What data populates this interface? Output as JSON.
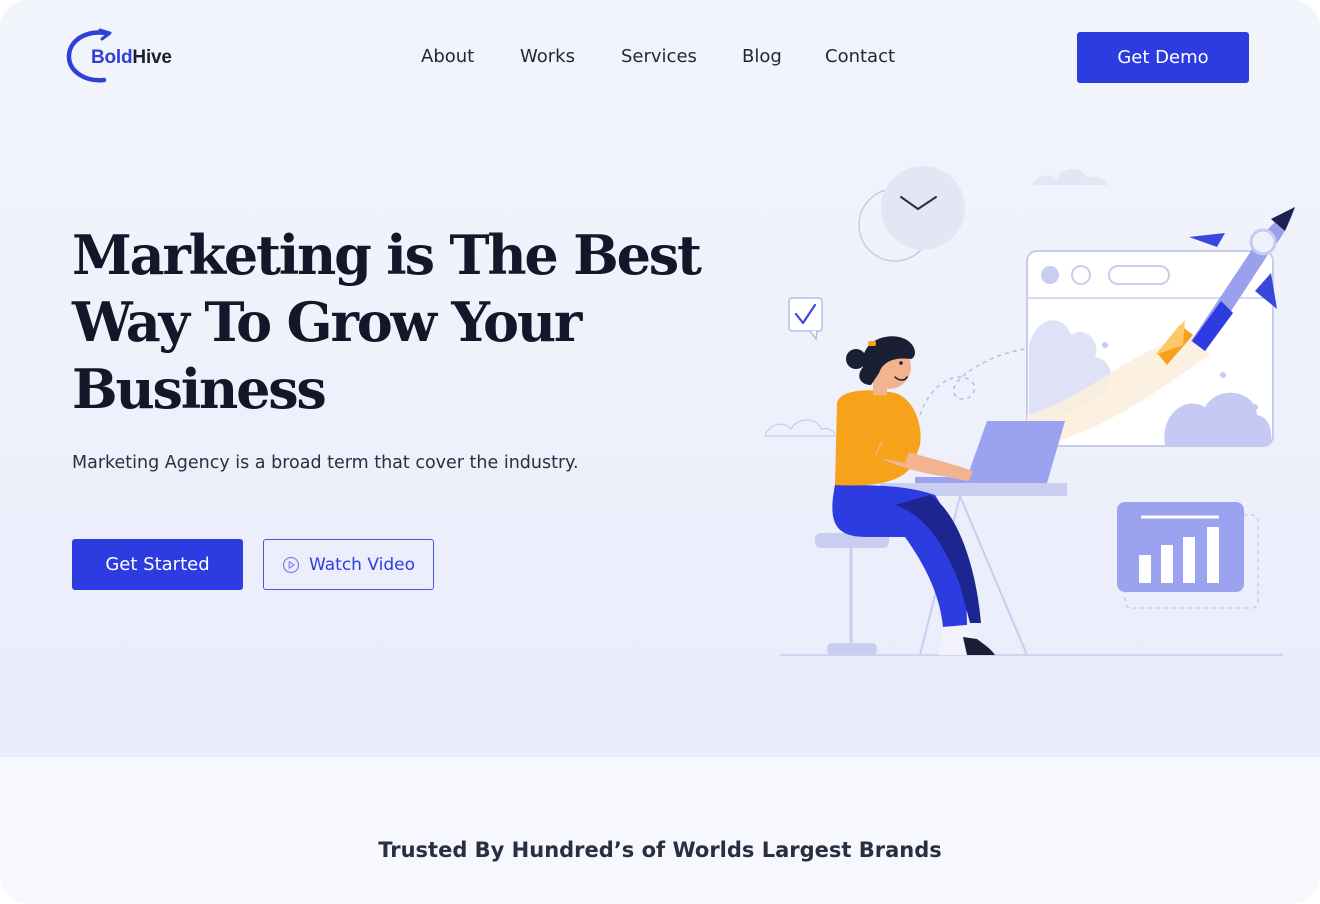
{
  "brand": {
    "name_part1": "Bold",
    "name_part2": "Hive",
    "primary_color": "#2d3ce0",
    "accent_color": "#f6a31b"
  },
  "nav": {
    "items": [
      {
        "label": "About"
      },
      {
        "label": "Works"
      },
      {
        "label": "Services"
      },
      {
        "label": "Blog"
      },
      {
        "label": "Contact"
      }
    ],
    "cta_label": "Get Demo"
  },
  "hero": {
    "headline_lines": [
      "Marketing is The Best",
      "Way To Grow Your",
      "Business"
    ],
    "subtext": "Marketing Agency is a broad term that cover the industry.",
    "primary_button": "Get Started",
    "secondary_button": "Watch Video",
    "secondary_button_icon": "play-circle-icon",
    "illustration_icons": [
      "clock-icon",
      "checkmark-chat-icon",
      "rocket-icon",
      "browser-window-icon",
      "bar-chart-icon",
      "laptop-icon",
      "cloud-icon"
    ]
  },
  "trusted": {
    "heading": "Trusted By Hundred’s of Worlds Largest Brands"
  }
}
